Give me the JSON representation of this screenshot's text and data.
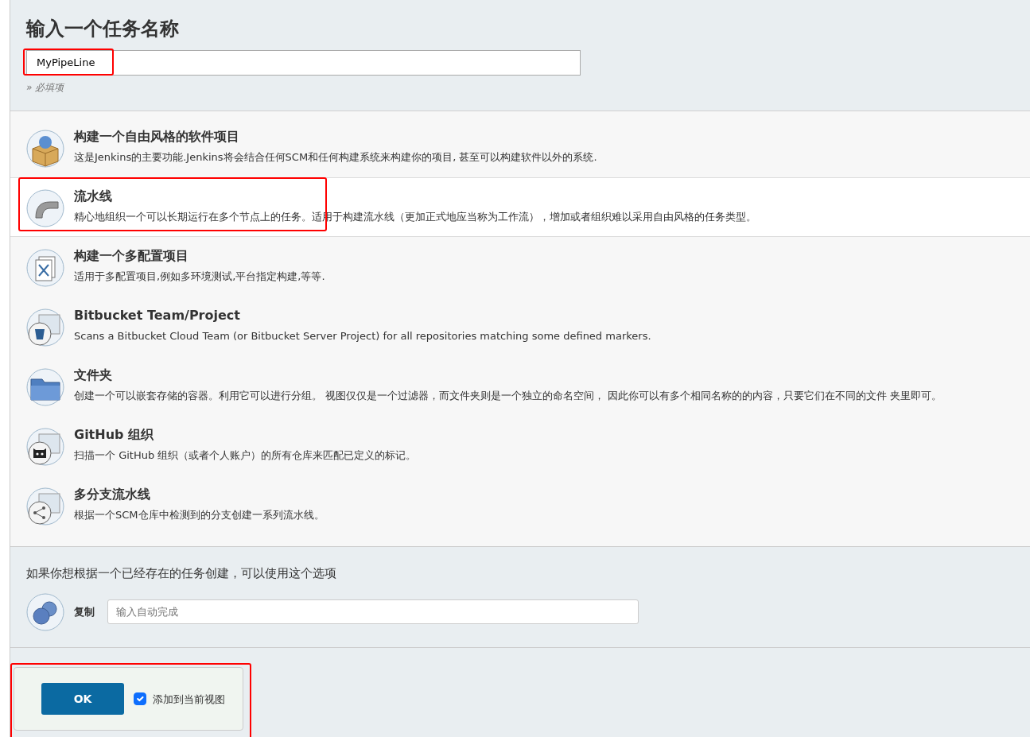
{
  "name_section": {
    "title": "输入一个任务名称",
    "value": "MyPipeLine",
    "highlighted": true,
    "required_note": "» 必填项"
  },
  "item_types": [
    {
      "kind": "freestyle",
      "title": "构建一个自由风格的软件项目",
      "description": "这是Jenkins的主要功能.Jenkins将会结合任何SCM和任何构建系统来构建你的项目, 甚至可以构建软件以外的系统.",
      "selected": false,
      "highlighted": false
    },
    {
      "kind": "pipeline",
      "title": "流水线",
      "description": "精心地组织一个可以长期运行在多个节点上的任务。适用于构建流水线（更加正式地应当称为工作流），增加或者组织难以采用自由风格的任务类型。",
      "selected": true,
      "highlighted": true
    },
    {
      "kind": "matrix",
      "title": "构建一个多配置项目",
      "description": "适用于多配置项目,例如多环境测试,平台指定构建,等等.",
      "selected": false,
      "highlighted": false
    },
    {
      "kind": "bitbucket",
      "title": "Bitbucket Team/Project",
      "description": "Scans a Bitbucket Cloud Team (or Bitbucket Server Project) for all repositories matching some defined markers.",
      "selected": false,
      "highlighted": false
    },
    {
      "kind": "folder",
      "title": "文件夹",
      "description": "创建一个可以嵌套存储的容器。利用它可以进行分组。 视图仅仅是一个过滤器，而文件夹则是一个独立的命名空间， 因此你可以有多个相同名称的的内容，只要它们在不同的文件 夹里即可。",
      "selected": false,
      "highlighted": false
    },
    {
      "kind": "github",
      "title": "GitHub 组织",
      "description": "扫描一个 GitHub 组织（或者个人账户）的所有仓库来匹配已定义的标记。",
      "selected": false,
      "highlighted": false
    },
    {
      "kind": "multibranch",
      "title": "多分支流水线",
      "description": "根据一个SCM仓库中检测到的分支创建一系列流水线。",
      "selected": false,
      "highlighted": false
    }
  ],
  "copy_section": {
    "hint": "如果你想根据一个已经存在的任务创建，可以使用这个选项",
    "label": "复制",
    "placeholder": "输入自动完成"
  },
  "footer": {
    "ok_button": "OK",
    "add_to_view": {
      "label": "添加到当前视图",
      "checked": true
    },
    "highlighted": true
  }
}
